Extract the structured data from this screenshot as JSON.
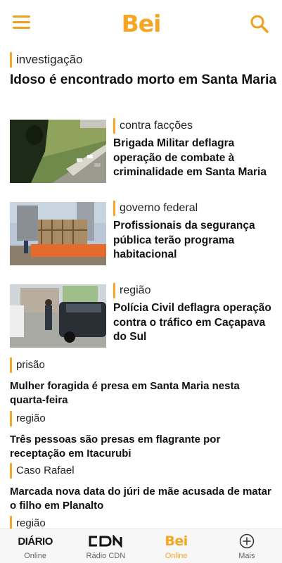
{
  "header": {
    "logo": "Bei",
    "menu_icon": "hamburger-menu-icon",
    "search_icon": "search-icon",
    "accent_color": "#f5a623"
  },
  "hero": {
    "tag": "investigação",
    "title": "Idoso é encontrado morto em Santa Maria"
  },
  "cards": [
    {
      "tag": "contra facções",
      "title": "Brigada Militar deflagra operação de combate à criminalidade em Santa Maria",
      "image": "aerial-view-photo"
    },
    {
      "tag": "governo federal",
      "title": "Profissionais da segurança pública terão programa habitacional",
      "image": "construction-site-photo"
    },
    {
      "tag": "região",
      "title": "Polícia Civil deflagra operação contra o tráfico em Caçapava do Sul",
      "image": "police-vehicle-photo"
    }
  ],
  "list": [
    {
      "tag": "prisão",
      "title": "Mulher foragida é presa em Santa Maria nesta quarta-feira"
    },
    {
      "tag": "região",
      "title": "Três pessoas são presas em flagrante por receptação em Itacurubi"
    },
    {
      "tag": "Caso Rafael",
      "title": "Marcada nova data do júri de mãe acusada de matar o filho em Planalto"
    },
    {
      "tag": "região",
      "title": ""
    }
  ],
  "bottom_nav": [
    {
      "logo": "DIÁRIO",
      "label": "Online"
    },
    {
      "logo": "CDN",
      "label": "Rádio CDN"
    },
    {
      "logo": "Bei",
      "label": "Online",
      "active": true
    },
    {
      "logo": "plus-circle-icon",
      "label": "Mais"
    }
  ]
}
